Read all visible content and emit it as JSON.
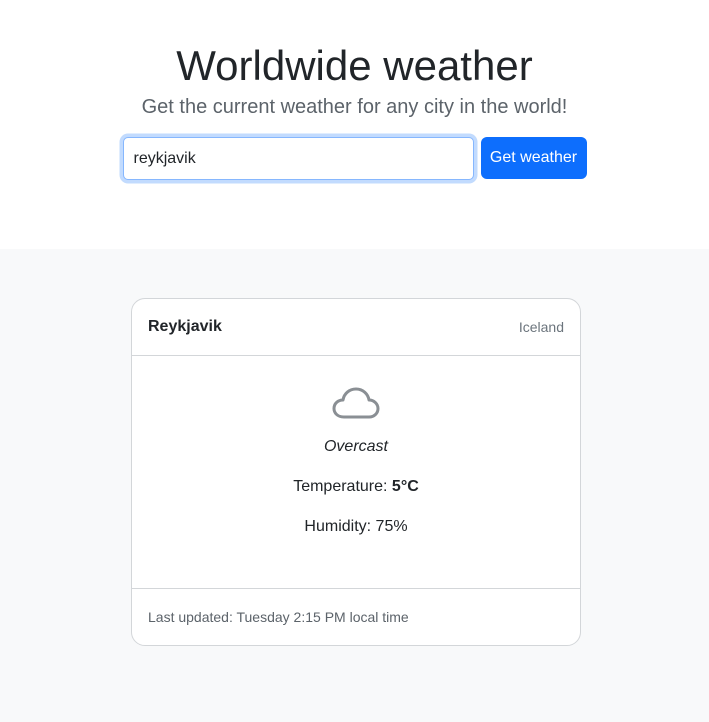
{
  "header": {
    "title": "Worldwide weather",
    "subtitle": "Get the current weather for any city in the world!"
  },
  "search": {
    "value": "reykjavik",
    "placeholder": "",
    "button_label": "Get weather"
  },
  "weather_card": {
    "city": "Reykjavik",
    "country": "Iceland",
    "icon": "cloud-icon",
    "condition": "Overcast",
    "temperature_label": "Temperature:",
    "temperature_value": "5°C",
    "humidity_label": "Humidity:",
    "humidity_value": "75%",
    "last_updated": "Last updated: Tuesday 2:15 PM local time"
  },
  "colors": {
    "accent": "#0d6efd",
    "hero_bg": "#ffffff",
    "page_bg": "#f8f9fa",
    "icon_stroke": "#8a8f94"
  }
}
